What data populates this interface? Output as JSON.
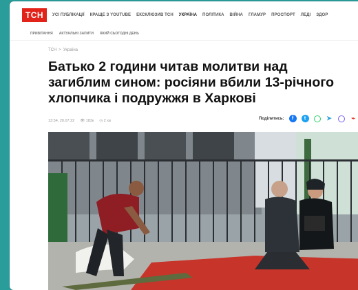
{
  "header": {
    "logo": "ТСН",
    "nav": [
      "УСІ ПУБЛІКАЦІЇ",
      "КРАЩЕ З YOUTUBE",
      "ЕКСКЛЮЗИВ ТСН",
      "УКРАЇНА",
      "ПОЛІТИКА",
      "ВІЙНА",
      "ГЛАМУР",
      "ПРОСПОРТ",
      "ЛЕДІ",
      "ЗДОР"
    ],
    "active_nav": "УКРАЇНА",
    "subnav": [
      "ПРИВІТАННЯ",
      "АКТУАЛЬНІ ЗАПИТИ",
      "ЯКИЙ СЬОГОДНІ ДЕНЬ"
    ]
  },
  "breadcrumb": [
    "ТСН",
    ">",
    "Україна"
  ],
  "article": {
    "title": "Батько 2 години читав молитви над загиблим сином: росіяни вбили 13-річного хлопчика і подружжя в Харкові",
    "date": "13:54, 20.07.22",
    "views": "183к",
    "read_time": "2 хв"
  },
  "share": {
    "label": "Поділитись:",
    "icons": [
      "facebook-icon",
      "twitter-icon",
      "whatsapp-icon",
      "telegram-icon",
      "viber-icon",
      "link-icon"
    ]
  },
  "colors": {
    "brand": "#e2231a",
    "background": "#2a9c9a",
    "text": "#111111"
  }
}
